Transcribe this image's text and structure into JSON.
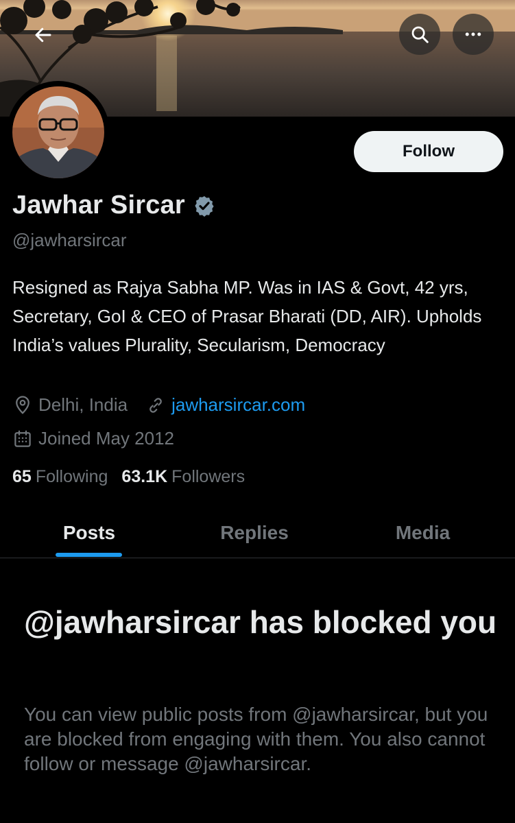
{
  "header": {
    "back_icon": "arrow-left-icon",
    "search_icon": "search-icon",
    "more_icon": "more-horizontal-icon"
  },
  "profile": {
    "display_name": "Jawhar Sircar",
    "handle": "@jawharsircar",
    "verified": true,
    "bio": "Resigned as Rajya Sabha MP. Was in IAS & Govt, 42 yrs, Secretary, GoI & CEO of Prasar Bharati (DD, AIR). Upholds India’s values Plurality, Secularism, Democracy",
    "location": "Delhi, India",
    "website": "jawharsircar.com",
    "joined": "Joined May 2012",
    "following_count": "65",
    "following_label": "Following",
    "followers_count": "63.1K",
    "followers_label": "Followers",
    "follow_label": "Follow"
  },
  "tabs": [
    {
      "label": "Posts",
      "active": true
    },
    {
      "label": "Replies",
      "active": false
    },
    {
      "label": "Media",
      "active": false
    }
  ],
  "blocked": {
    "title": "@jawharsircar has blocked you",
    "message": "You can view public posts from @jawharsircar, but you are blocked from engaging with them. You also cannot follow or message @jawharsircar."
  },
  "colors": {
    "accent": "#1d9bf0",
    "verified_badge": "#829aab",
    "muted_text": "#71767b",
    "primary_text": "#e7e9ea",
    "background": "#000000"
  }
}
